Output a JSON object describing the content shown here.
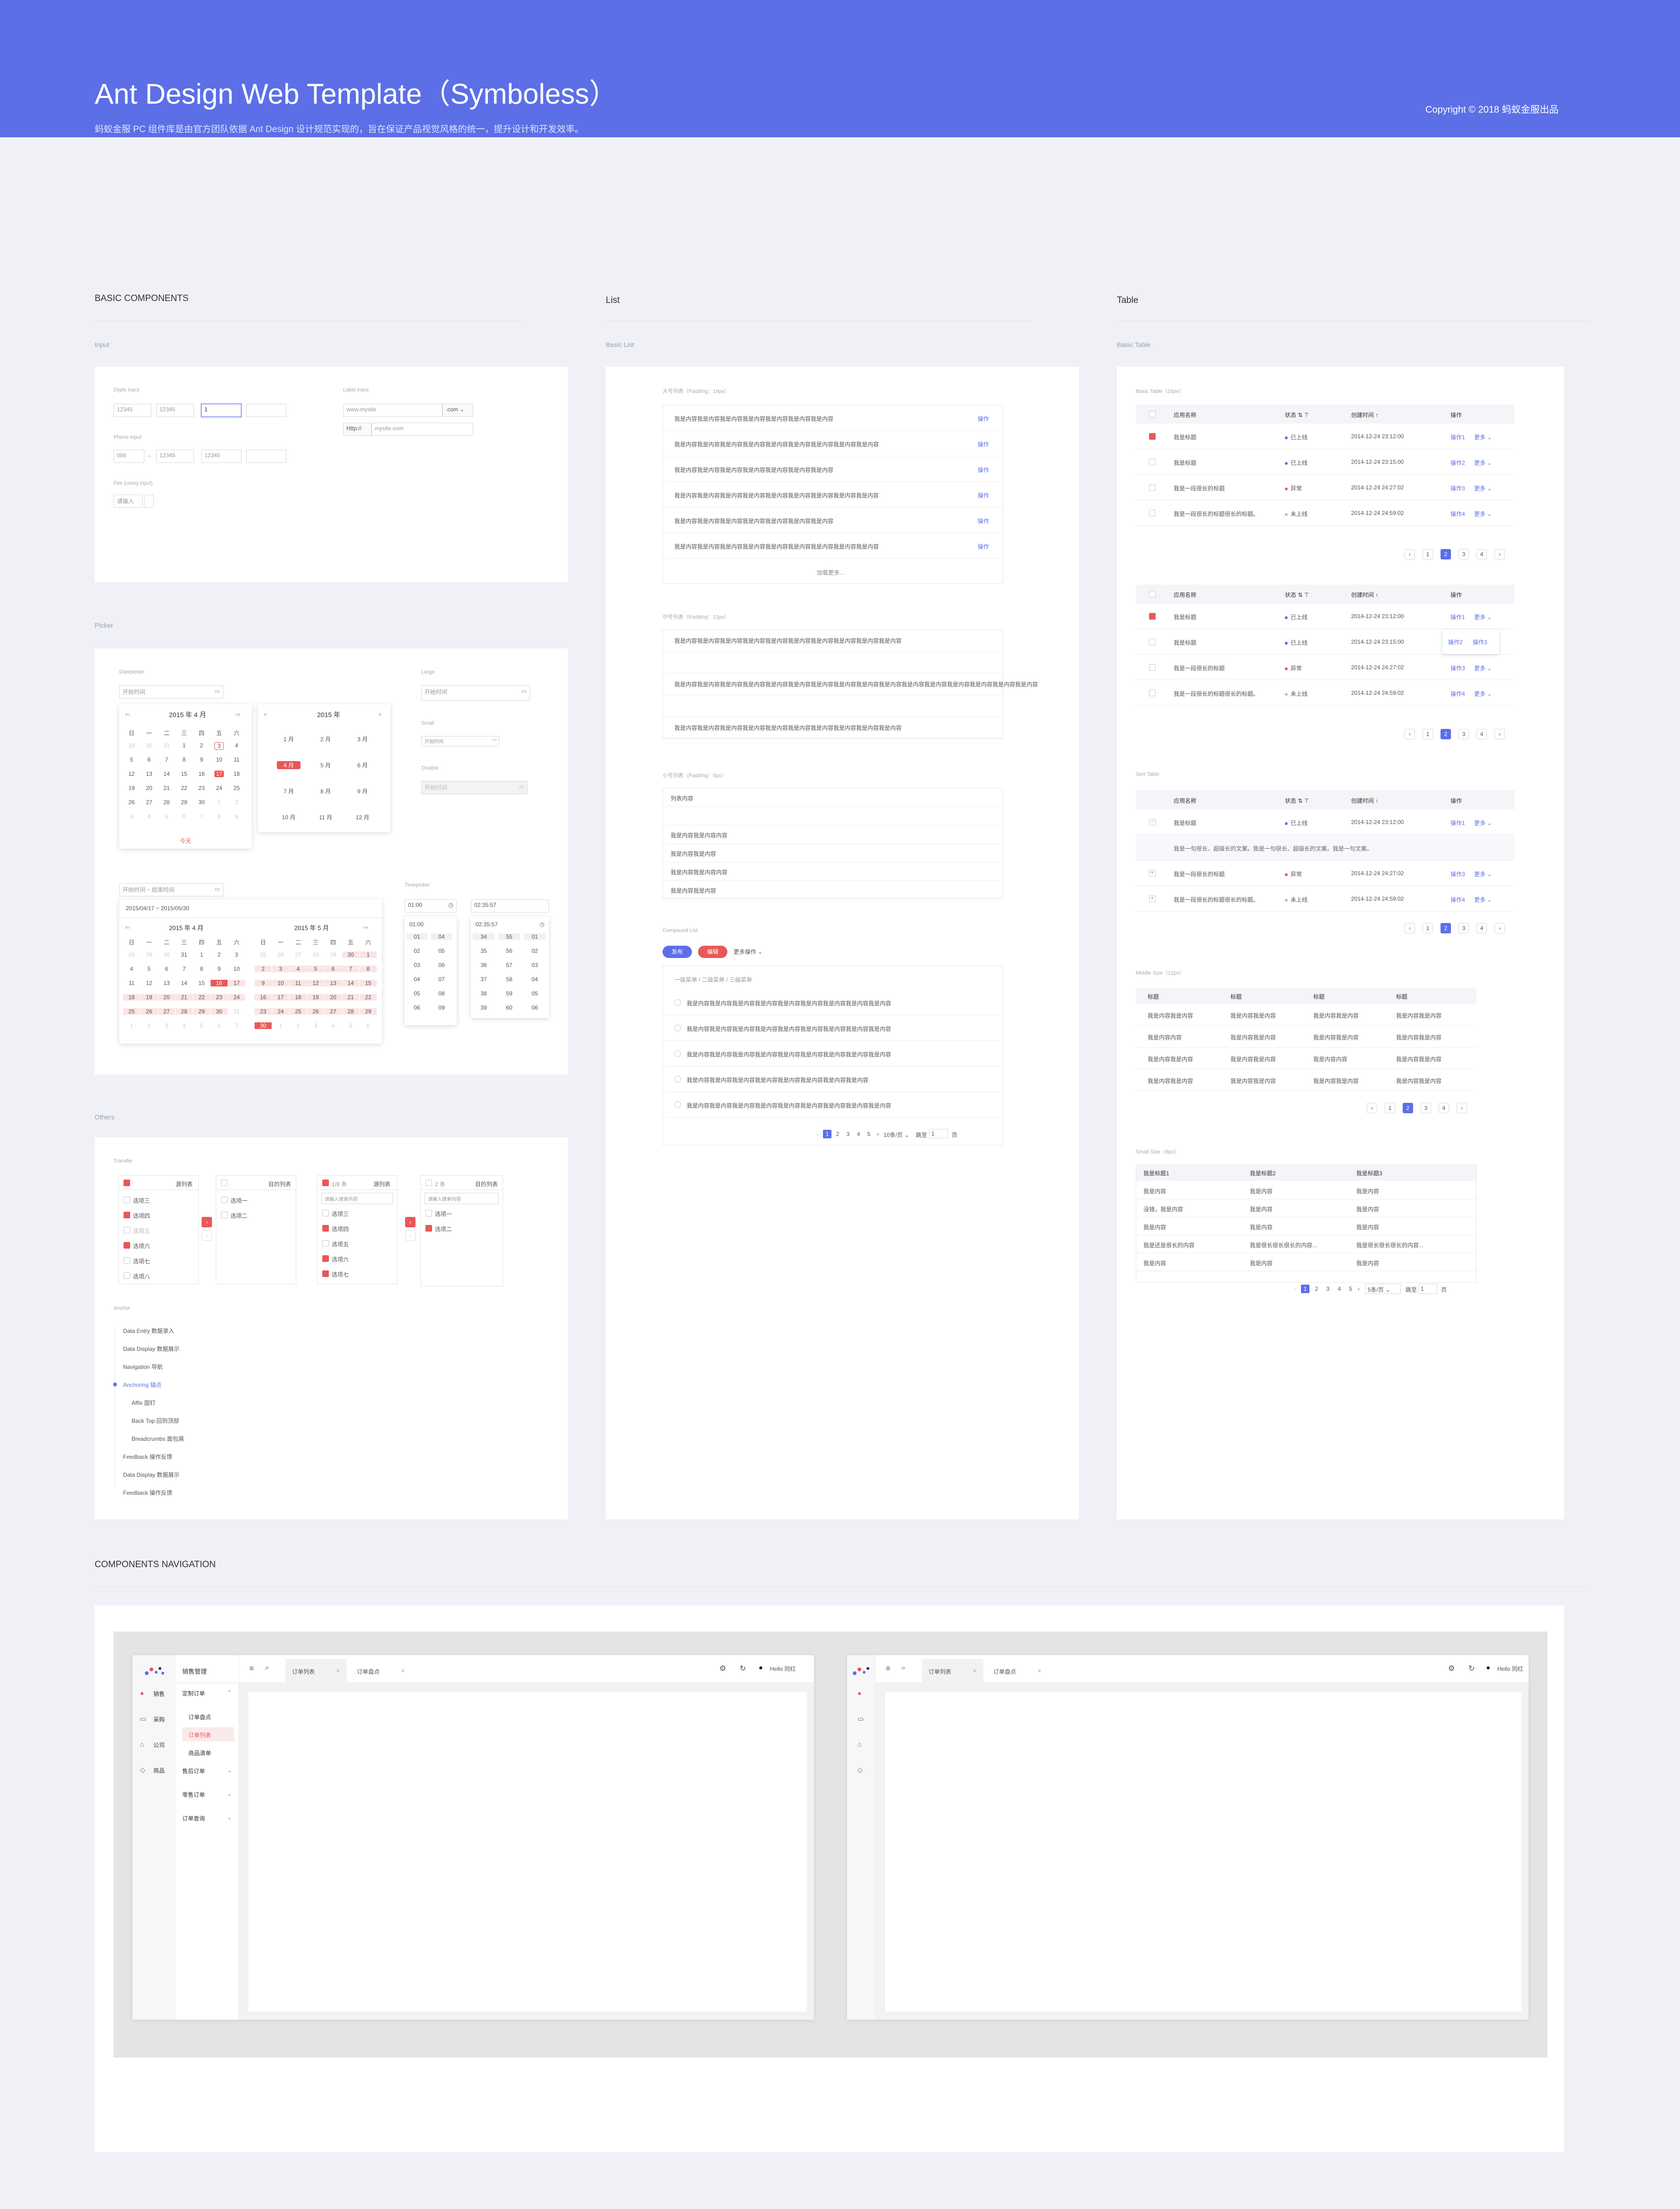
{
  "header": {
    "title": "Ant Design Web Template（Symboless）",
    "subtitle": "蚂蚁金服 PC 组件库是由官方团队依据 Ant Design 设计规范实现的，旨在保证产品视觉风格的统一，提升设计和开发效率。",
    "copyright": "Copyright © 2018 蚂蚁金服出品"
  },
  "colors": {
    "brand": "#5c6fe7",
    "accent": "#e8585a",
    "background": "#f0f1f6"
  },
  "sections": {
    "basic": "BASIC COMPONENTS",
    "list": "List",
    "table": "Table",
    "nav": "COMPONENTS NAVIGATION"
  },
  "sub": {
    "input": "Input",
    "picker": "Picker",
    "others": "Others",
    "basic_list": "Basic List",
    "basic_table": "Basic Table"
  },
  "input": {
    "digits_label": "Digits input",
    "digits": [
      "12345",
      "12345",
      "1",
      ""
    ],
    "label_input": "Label input",
    "www_placeholder": "www.mysite",
    "com": ".com",
    "http": "Http://",
    "http_placeholder": "mysite.com",
    "phone_label": "Phone input",
    "phone": [
      "086",
      "12345",
      "12345",
      ""
    ],
    "fee_label": "Fee (using input)",
    "fee_placeholder": "请输入"
  },
  "picker": {
    "datepicker_label": "Datepicker",
    "date_placeholder": "开始时间",
    "month_title": "2015 年 4 月",
    "year_title": "2015 年",
    "weekdays": [
      "日",
      "一",
      "二",
      "三",
      "四",
      "五",
      "六"
    ],
    "months": [
      "1 月",
      "2 月",
      "3 月",
      "4 月",
      "5 月",
      "6 月",
      "7 月",
      "8 月",
      "9 月",
      "10 月",
      "11 月",
      "12 月"
    ],
    "today": "今天",
    "large_label": "Large",
    "large_placeholder": "开始时间",
    "small_label": "Small",
    "small_placeholder": "开始时间",
    "disable_label": "Disable",
    "disable_placeholder": "开始时间",
    "range_placeholder": "开始时间 ~ 结束时间",
    "range_value": "2015/04/17 ~ 2015/05/30",
    "range_left": "2015 年 4 月",
    "range_right": "2015 年 5 月",
    "timepicker_label": "Timepicker",
    "time1": "01:00",
    "time2": "02:35:57",
    "time_cols_1": [
      [
        "01",
        "02",
        "03",
        "04",
        "05",
        "06"
      ],
      [
        "04",
        "05",
        "06",
        "07",
        "08",
        "09"
      ]
    ],
    "time_cols_2": [
      [
        "34",
        "35",
        "36",
        "37",
        "38",
        "39"
      ],
      [
        "55",
        "56",
        "57",
        "58",
        "59",
        "60"
      ],
      [
        "01",
        "02",
        "03",
        "04",
        "05",
        "06"
      ]
    ]
  },
  "others": {
    "transfer_label": "Transfer",
    "source": "源列表",
    "target": "目的列表",
    "left_items": [
      "选项三",
      "选项四",
      "选项五",
      "选项六",
      "选项七",
      "选项八"
    ],
    "right_items": [
      "选项一",
      "选项二"
    ],
    "search_placeholder": "请输入搜索内容",
    "count_left": "1/8 条",
    "count_right": "2 条",
    "left2_items": [
      "选项三",
      "选项四",
      "选项五",
      "选项六",
      "选项七"
    ],
    "anchor_label": "Anchor",
    "anchor_items": [
      {
        "en": "Data Entry",
        "zh": "数据录入"
      },
      {
        "en": "Data Display",
        "zh": "数据展示"
      },
      {
        "en": "Navigation",
        "zh": "导航"
      },
      {
        "en": "Anchoring",
        "zh": "锚点"
      },
      {
        "en": "Affix",
        "zh": "固钉"
      },
      {
        "en": "Back Top",
        "zh": "回到顶部"
      },
      {
        "en": "Breadcrumbs",
        "zh": "面包屑"
      },
      {
        "en": "Feedback",
        "zh": "操作反馈"
      },
      {
        "en": "Data Display",
        "zh": "数据展示"
      },
      {
        "en": "Feedback",
        "zh": "操作反馈"
      }
    ]
  },
  "list": {
    "large_label": "大号列表（Padding：16px）",
    "item": "我是内容我是内容我是内容我是内容我是内容我是内容我是内容",
    "item_long": "我是内容我是内容我是内容我是内容我是内容我是内容我是内容我是内容我是内容",
    "action": "操作",
    "load_more": "加载更多...",
    "medium_label": "中号列表（Padding：12px）",
    "small_label": "小号列表（Padding：8px）",
    "small_first": "列表内容",
    "small_item": "我是内容我是内容",
    "compound_label": "Compound List",
    "btn_publish": "发布",
    "btn_edit": "编辑",
    "btn_more": "更多操作",
    "breadcrumb": [
      "一级菜单",
      "二级菜单",
      "三级菜单"
    ],
    "compound_item": "我是内容我是内容我是内容我是内容我是内容我是内容我是内容我是内容",
    "pager_size": "10条/页",
    "jump": "跳至",
    "page": "页",
    "jump_val": "1"
  },
  "table": {
    "basic_label": "Basic Table（16px）",
    "cols": [
      "应用名称",
      "状态",
      "创建时间",
      "操作"
    ],
    "rows": [
      {
        "name": "我是标题",
        "status": "已上线",
        "time": "2014-12-24 23:12:00",
        "op": "操作1",
        "more": "更多",
        "checked": true,
        "color": "#5c6fe7"
      },
      {
        "name": "我是标题",
        "status": "已上线",
        "time": "2014-12-24 23:15:00",
        "op": "操作2",
        "more": "更多",
        "checked": false,
        "color": "#5c6fe7"
      },
      {
        "name": "我是一段很长的标题",
        "status": "异常",
        "time": "2014-12-24 24:27:02",
        "op": "操作3",
        "more": "更多",
        "checked": false,
        "color": "#e8585a"
      },
      {
        "name": "我是一段很长的标题很长的标题。",
        "status": "未上线",
        "time": "2014-12-24 24:59:02",
        "op": "操作4",
        "more": "更多",
        "checked": false,
        "color": "#bbbbbb"
      }
    ],
    "popup": [
      "操作2",
      "操作3"
    ],
    "sort_label": "Sort Table",
    "expand_text": "我是一句很长、超级长的文案。我是一句很长、超级长的文案。我是一句文案。",
    "middle_label": "Middle Size（12px）",
    "mid_cols": [
      "标题",
      "标题",
      "标题",
      "标题"
    ],
    "mid_cell": "我是内容我是内容",
    "mid_cell_short": "我是内容内容",
    "small_label": "Small Size（8px）",
    "small_cols": [
      "我是标题1",
      "我是标题2",
      "我是标题3"
    ],
    "small_rows": [
      [
        "我是内容",
        "我是内容",
        "我是内容"
      ],
      [
        "没错，我是内容",
        "我是内容",
        "我是内容"
      ],
      [
        "我是内容",
        "我是内容",
        "我是内容"
      ],
      [
        "我是还是很长的内容",
        "我是很长很长很长的内容...",
        "我是很长很长很长的内容..."
      ],
      [
        "我是内容",
        "我是内容",
        "我是内容"
      ]
    ],
    "pages": [
      "1",
      "2",
      "3",
      "4"
    ],
    "pager_size": "5条/页",
    "jump": "跳至",
    "page": "页",
    "jump_val": "1"
  },
  "navigation": {
    "menu_title": "销售管理",
    "rail": [
      "销售",
      "采购",
      "公司",
      "商品"
    ],
    "menu": [
      {
        "label": "定制订单",
        "open": true
      },
      {
        "label": "订单盘点",
        "child": true
      },
      {
        "label": "订单列表",
        "child": true,
        "active": true
      },
      {
        "label": "商品清单",
        "child": true
      },
      {
        "label": "售后订单"
      },
      {
        "label": "零售订单"
      },
      {
        "label": "订单查询"
      }
    ],
    "tabs": [
      "订单列表",
      "订单盘点"
    ],
    "user": "Hello 同红"
  }
}
